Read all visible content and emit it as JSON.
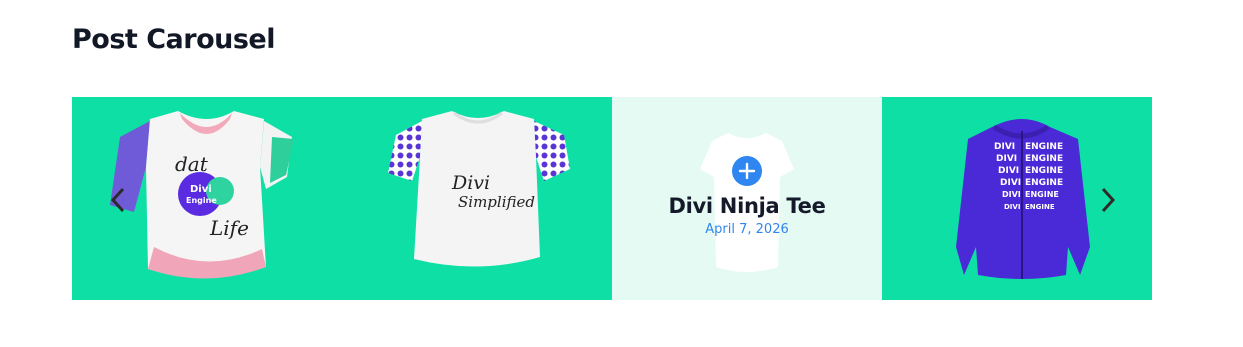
{
  "heading": "Post Carousel",
  "carousel": {
    "slides": [
      {
        "kind": "tshirt-print",
        "texts": [
          "dat",
          "Divi",
          "Engine",
          "Life"
        ]
      },
      {
        "kind": "tshirt-dots",
        "texts": [
          "Divi",
          "Simplified"
        ]
      },
      {
        "kind": "tshirt-plain",
        "title": "Divi Ninja Tee",
        "date": "April 7, 2026"
      },
      {
        "kind": "hoodie",
        "texts": [
          "DIVI",
          "ENGINE"
        ]
      }
    ],
    "prev_icon": "chevron-left-icon",
    "next_icon": "chevron-right-icon",
    "plus_icon": "plus-icon"
  },
  "colors": {
    "slide_bg": "#0ee0a5",
    "active_bg": "#e4faf3",
    "accent": "#2f86f0",
    "hoodie": "#4a2ad6"
  }
}
